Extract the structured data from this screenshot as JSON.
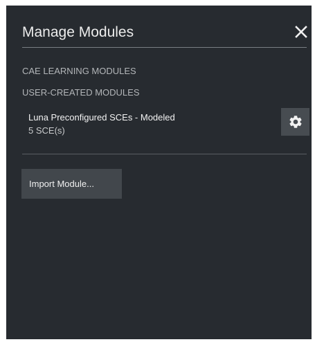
{
  "dialog": {
    "title": "Manage Modules",
    "close_icon": "close-icon"
  },
  "sections": {
    "cae_label": "CAE LEARNING MODULES",
    "user_label": "USER-CREATED MODULES"
  },
  "modules": [
    {
      "name": "Luna Preconfigured SCEs - Modeled",
      "count": "5 SCE(s)",
      "settings_icon": "gear-icon"
    }
  ],
  "actions": {
    "import_label": "Import Module..."
  },
  "colors": {
    "panel_bg": "#272b30",
    "button_bg": "#42474c",
    "gear_button_bg": "#474c51",
    "text_primary": "#ececec",
    "text_secondary": "#b3b6b9"
  }
}
